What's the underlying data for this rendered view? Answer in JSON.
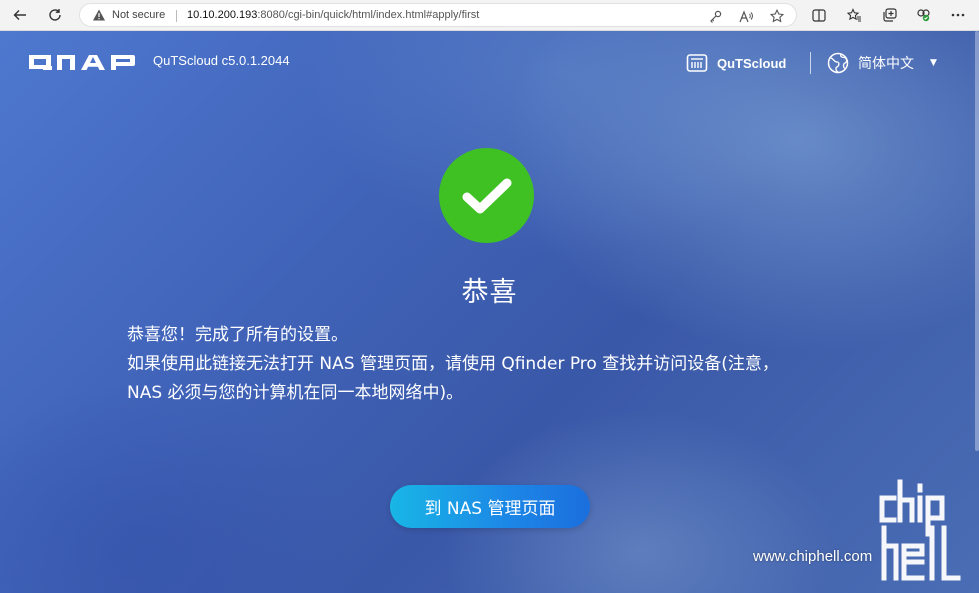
{
  "browser": {
    "security_label": "Not secure",
    "url_host": "10.10.200.193",
    "url_rest": ":8080/cgi-bin/quick/html/index.html#apply/first",
    "icons": [
      "back-icon",
      "refresh-icon",
      "warning-icon",
      "key-icon",
      "read-aloud-icon",
      "favorite-star-icon",
      "split-screen-icon",
      "favorites-icon",
      "collections-icon",
      "extension-icon",
      "more-icon"
    ]
  },
  "header": {
    "logo_text": "QNAP",
    "version": "QuTScloud c5.0.1.2044",
    "qutscloud_label": "QuTScloud",
    "language": "简体中文"
  },
  "main": {
    "title": "恭喜",
    "lines": [
      "恭喜您！完成了所有的设置。",
      "如果使用此链接无法打开 NAS 管理页面，请使用 Qfinder Pro 查找并访问设备(注意，",
      "NAS 必须与您的计算机在同一本地网络中)。"
    ],
    "button_label": "到 NAS 管理页面"
  },
  "watermark": {
    "url": "www.chiphell.com",
    "logo_text": "chip hell"
  },
  "colors": {
    "success": "#3fc124",
    "button_start": "#19b6e6",
    "button_end": "#1b6fde",
    "background": "#3d5fb4"
  }
}
